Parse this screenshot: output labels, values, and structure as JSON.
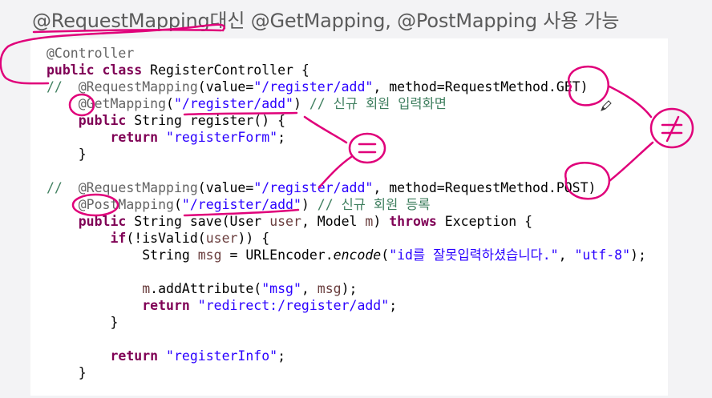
{
  "title": {
    "part1": "@RequestMapping",
    "part2": "대신 @GetMapping, @PostMapping 사용 가능"
  },
  "code": [
    [
      {
        "c": "ann",
        "t": "@Controller"
      }
    ],
    [
      {
        "c": "kw",
        "t": "public class "
      },
      {
        "c": "plain",
        "t": "RegisterController {"
      }
    ],
    [
      {
        "c": "cmt",
        "t": "//  "
      },
      {
        "c": "ann",
        "t": "@RequestMapping"
      },
      {
        "c": "plain",
        "t": "(value="
      },
      {
        "c": "str",
        "t": "\"/register/add\""
      },
      {
        "c": "plain",
        "t": ", method=RequestMethod."
      },
      {
        "c": "plain",
        "t": "GET)"
      }
    ],
    [
      {
        "c": "plain",
        "t": "    "
      },
      {
        "c": "ann",
        "t": "@GetMapping"
      },
      {
        "c": "plain",
        "t": "("
      },
      {
        "c": "str",
        "t": "\"/register/add\""
      },
      {
        "c": "plain",
        "t": ") "
      },
      {
        "c": "cmt",
        "t": "// 신규 회원 입력화면"
      }
    ],
    [
      {
        "c": "plain",
        "t": "    "
      },
      {
        "c": "kw",
        "t": "public "
      },
      {
        "c": "plain",
        "t": "String register() {"
      }
    ],
    [
      {
        "c": "plain",
        "t": "        "
      },
      {
        "c": "kw",
        "t": "return "
      },
      {
        "c": "str",
        "t": "\"registerForm\""
      },
      {
        "c": "plain",
        "t": ";"
      }
    ],
    [
      {
        "c": "plain",
        "t": "    }"
      }
    ],
    [
      {
        "c": "plain",
        "t": ""
      }
    ],
    [
      {
        "c": "cmt",
        "t": "//  "
      },
      {
        "c": "ann",
        "t": "@RequestMapping"
      },
      {
        "c": "plain",
        "t": "(value="
      },
      {
        "c": "str",
        "t": "\"/register/add\""
      },
      {
        "c": "plain",
        "t": ", method=RequestMethod."
      },
      {
        "c": "plain",
        "t": "POST)"
      }
    ],
    [
      {
        "c": "plain",
        "t": "    "
      },
      {
        "c": "ann",
        "t": "@PostMapping"
      },
      {
        "c": "plain",
        "t": "("
      },
      {
        "c": "str",
        "t": "\"/register/add\""
      },
      {
        "c": "plain",
        "t": ") "
      },
      {
        "c": "cmt",
        "t": "// 신규 회원 등록"
      }
    ],
    [
      {
        "c": "plain",
        "t": "    "
      },
      {
        "c": "kw",
        "t": "public "
      },
      {
        "c": "plain",
        "t": "String save(User "
      },
      {
        "c": "var",
        "t": "user"
      },
      {
        "c": "plain",
        "t": ", Model "
      },
      {
        "c": "var",
        "t": "m"
      },
      {
        "c": "plain",
        "t": ") "
      },
      {
        "c": "kw",
        "t": "throws "
      },
      {
        "c": "plain",
        "t": "Exception {"
      }
    ],
    [
      {
        "c": "plain",
        "t": "        "
      },
      {
        "c": "kw",
        "t": "if"
      },
      {
        "c": "plain",
        "t": "(!isValid("
      },
      {
        "c": "var",
        "t": "user"
      },
      {
        "c": "plain",
        "t": ")) {"
      }
    ],
    [
      {
        "c": "plain",
        "t": "            String "
      },
      {
        "c": "var",
        "t": "msg"
      },
      {
        "c": "plain",
        "t": " = URLEncoder."
      },
      {
        "c": "it",
        "t": "encode"
      },
      {
        "c": "plain",
        "t": "("
      },
      {
        "c": "str",
        "t": "\"id를 잘못입력하셨습니다.\""
      },
      {
        "c": "plain",
        "t": ", "
      },
      {
        "c": "str",
        "t": "\"utf-8\""
      },
      {
        "c": "plain",
        "t": ");"
      }
    ],
    [
      {
        "c": "plain",
        "t": ""
      }
    ],
    [
      {
        "c": "plain",
        "t": "            "
      },
      {
        "c": "var",
        "t": "m"
      },
      {
        "c": "plain",
        "t": ".addAttribute("
      },
      {
        "c": "str",
        "t": "\"msg\""
      },
      {
        "c": "plain",
        "t": ", "
      },
      {
        "c": "var",
        "t": "msg"
      },
      {
        "c": "plain",
        "t": ");"
      }
    ],
    [
      {
        "c": "plain",
        "t": "            "
      },
      {
        "c": "kw",
        "t": "return "
      },
      {
        "c": "str",
        "t": "\"redirect:/register/add\""
      },
      {
        "c": "plain",
        "t": ";"
      }
    ],
    [
      {
        "c": "plain",
        "t": "        }"
      }
    ],
    [
      {
        "c": "plain",
        "t": ""
      }
    ],
    [
      {
        "c": "plain",
        "t": "        "
      },
      {
        "c": "kw",
        "t": "return "
      },
      {
        "c": "str",
        "t": "\"registerInfo\""
      },
      {
        "c": "plain",
        "t": ";"
      }
    ],
    [
      {
        "c": "plain",
        "t": "    }"
      }
    ]
  ],
  "marks": {
    "equal_sign": "=",
    "not_equal_sign": "≠"
  },
  "colors": {
    "ink": "#e0007a",
    "keyword": "#7f0055",
    "string": "#2a00ff",
    "comment": "#3f7f5f",
    "annotation": "#646464"
  }
}
